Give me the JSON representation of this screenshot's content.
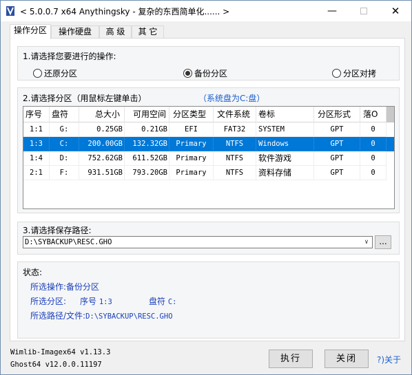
{
  "window": {
    "title": "< 5.0.0.7 x64 Anythingsky - 复杂的东西简单化...... >",
    "min_glyph": "—",
    "close_glyph": "✕"
  },
  "tabs": [
    "操作分区",
    "操作硬盘",
    "高 级",
    "其 它"
  ],
  "operation": {
    "label": "1.请选择您要进行的操作:",
    "options": [
      "还原分区",
      "备份分区",
      "分区对拷"
    ],
    "selected": "备份分区"
  },
  "partition": {
    "label": "2.请选择分区（用鼠标左键单击）",
    "system_hint": "（系统盘为C:盘）",
    "columns": [
      "序号",
      "盘符",
      "总大小",
      "可用空间",
      "分区类型",
      "文件系统",
      "卷标",
      "分区形式",
      "落O"
    ],
    "rows": [
      [
        "1:1",
        "G:",
        "0.25GB",
        "0.21GB",
        "EFI",
        "FAT32",
        "SYSTEM",
        "GPT",
        "0"
      ],
      [
        "1:3",
        "C:",
        "200.00GB",
        "132.32GB",
        "Primary",
        "NTFS",
        "Windows",
        "GPT",
        "0"
      ],
      [
        "1:4",
        "D:",
        "752.62GB",
        "611.52GB",
        "Primary",
        "NTFS",
        "软件游戏",
        "GPT",
        "0"
      ],
      [
        "2:1",
        "F:",
        "931.51GB",
        "793.20GB",
        "Primary",
        "NTFS",
        "资料存储",
        "GPT",
        "0"
      ]
    ],
    "selected_row": 1
  },
  "save_path": {
    "label": "3.请选择保存路径:",
    "value": "D:\\SYBACKUP\\RESC.GHO",
    "dropdown_glyph": "∨",
    "browse_label": "..."
  },
  "status": {
    "title": "状态:",
    "operation_label": "所选操作:",
    "operation_value": "备份分区",
    "partition_label": "所选分区:",
    "partition_index_label": "序号",
    "partition_index_value": "1:3",
    "partition_drive_label": "盘符",
    "partition_drive_value": "C:",
    "path_label": "所选路径/文件:",
    "path_value": "D:\\SYBACKUP\\RESC.GHO"
  },
  "footer": {
    "wimlib": "Wimlib-Imagex64 v1.13.3",
    "ghost": "Ghost64 v12.0.0.11197",
    "execute_label": "执行",
    "close_label": "关闭",
    "about_label": "?)关于"
  }
}
